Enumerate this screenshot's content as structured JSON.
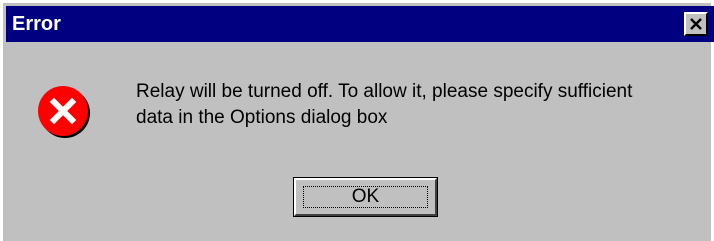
{
  "dialog": {
    "title": "Error",
    "message": "Relay will be turned off.  To allow it, please specify sufficient\ndata in the Options dialog box",
    "ok_label": "OK"
  },
  "icons": {
    "close": "close-icon",
    "error": "error-icon"
  },
  "colors": {
    "titlebar": "#000080",
    "face": "#c0c0c0",
    "error_red": "#ff0000"
  }
}
